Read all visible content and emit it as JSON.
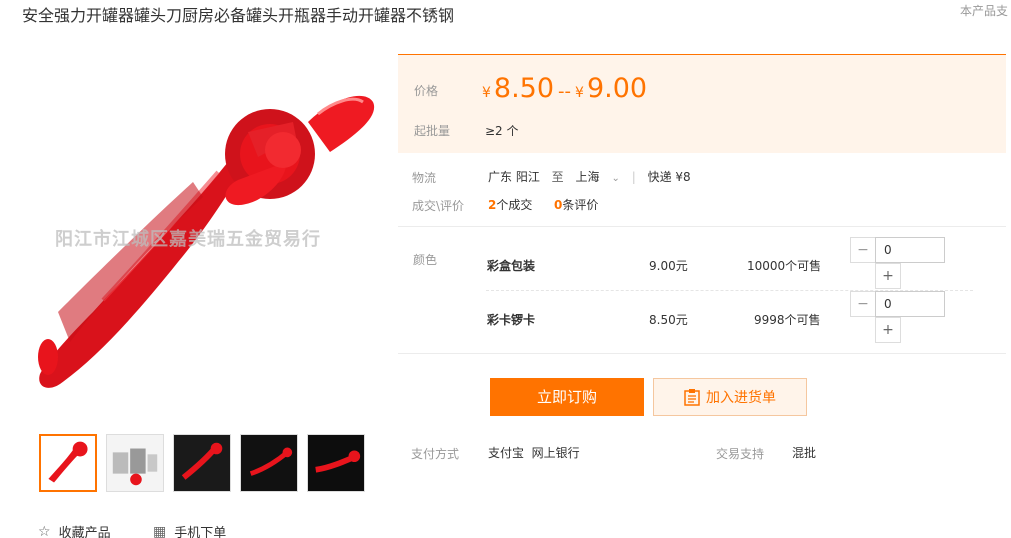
{
  "header": {
    "title": "安全强力开罐器罐头刀厨房必备罐头开瓶器手动开罐器不锈钢",
    "report": "本产品支"
  },
  "gallery": {
    "watermark": "阳江市江城区嘉美瑞五金贸易行",
    "favorite_label": "收藏产品",
    "mobile_order_label": "手机下单"
  },
  "price": {
    "label": "价格",
    "currency": "¥",
    "min": "8.50",
    "separator": "--",
    "max": "9.00",
    "moq_label": "起批量",
    "moq_value": "≥2 个"
  },
  "logistics": {
    "label": "物流",
    "from": "广东 阳江",
    "to_word": "至",
    "to": "上海",
    "shipping": "快递 ¥8"
  },
  "deals": {
    "label": "成交\\评价",
    "sold_count": "2",
    "sold_suffix": "个成交",
    "review_count": "0",
    "review_suffix": "条评价"
  },
  "sku": {
    "label": "颜色",
    "items": [
      {
        "name": "彩盒包装",
        "price": "9.00元",
        "stock": "10000个可售",
        "qty": "0"
      },
      {
        "name": "彩卡锣卡",
        "price": "8.50元",
        "stock": "9998个可售",
        "qty": "0"
      }
    ]
  },
  "actions": {
    "buy_now": "立即订购",
    "add_to_list": "加入进货单"
  },
  "payment": {
    "label": "支付方式",
    "methods": "支付宝  网上银行",
    "trade_label": "交易支持",
    "trade_value": "混批"
  },
  "colors": {
    "accent": "#ff7300",
    "price_bg": "#fff4ea",
    "product_red": "#e8141c"
  }
}
